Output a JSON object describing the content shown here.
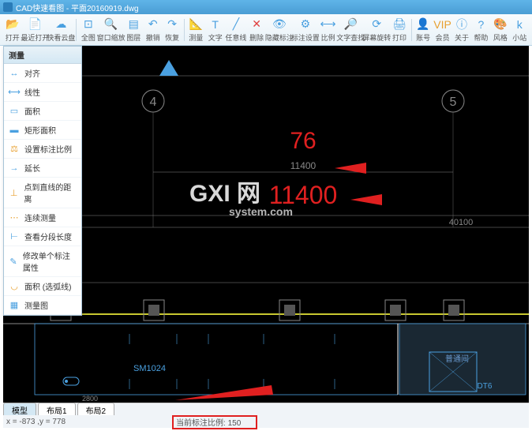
{
  "title": "CAD快速看图 - 平面20160919.dwg",
  "toolbar": [
    {
      "label": "打开",
      "icon": "📂",
      "color": "#e8a030"
    },
    {
      "label": "最近打开",
      "icon": "📄",
      "color": "#e8a030"
    },
    {
      "label": "快看云盘",
      "icon": "☁",
      "color": "#4aa0e0"
    },
    {
      "label": "全图",
      "icon": "⊡",
      "color": "#4aa0e0"
    },
    {
      "label": "窗口缩放",
      "icon": "🔍",
      "color": "#4aa0e0"
    },
    {
      "label": "图层",
      "icon": "▤",
      "color": "#4aa0e0"
    },
    {
      "label": "撤销",
      "icon": "↶",
      "color": "#4aa0e0"
    },
    {
      "label": "恢复",
      "icon": "↷",
      "color": "#4aa0e0"
    },
    {
      "label": "测量",
      "icon": "📐",
      "color": "#e8a030"
    },
    {
      "label": "文字",
      "icon": "T",
      "color": "#4aa0e0"
    },
    {
      "label": "任意线",
      "icon": "╱",
      "color": "#4aa0e0"
    },
    {
      "label": "删除",
      "icon": "✕",
      "color": "#e04040"
    },
    {
      "label": "隐藏标注",
      "icon": "👁",
      "color": "#4aa0e0"
    },
    {
      "label": "标注设置",
      "icon": "⚙",
      "color": "#4aa0e0"
    },
    {
      "label": "比例",
      "icon": "⟷",
      "color": "#4aa0e0"
    },
    {
      "label": "文字查找",
      "icon": "🔎",
      "color": "#4aa0e0"
    },
    {
      "label": "屏幕旋转",
      "icon": "⟳",
      "color": "#4aa0e0"
    },
    {
      "label": "打印",
      "icon": "🖨",
      "color": "#4aa0e0"
    },
    {
      "label": "账号",
      "icon": "👤",
      "color": "#e8a030"
    },
    {
      "label": "会员",
      "icon": "VIP",
      "color": "#e8a030"
    },
    {
      "label": "关于",
      "icon": "ⓘ",
      "color": "#4aa0e0"
    },
    {
      "label": "帮助",
      "icon": "?",
      "color": "#4aa0e0"
    },
    {
      "label": "风格",
      "icon": "🎨",
      "color": "#4aa0e0"
    },
    {
      "label": "小站",
      "icon": "k",
      "color": "#4aa0e0"
    }
  ],
  "dropdown": {
    "header": "测量",
    "items": [
      {
        "label": "对齐",
        "icon": "↔",
        "color": "#4aa0e0"
      },
      {
        "label": "线性",
        "icon": "⟷",
        "color": "#4aa0e0"
      },
      {
        "label": "面积",
        "icon": "▭",
        "color": "#4aa0e0"
      },
      {
        "label": "矩形面积",
        "icon": "▬",
        "color": "#4aa0e0"
      },
      {
        "label": "设置标注比例",
        "icon": "⚖",
        "color": "#e8a030"
      },
      {
        "label": "延长",
        "icon": "→",
        "color": "#4aa0e0"
      },
      {
        "label": "点到直线的距离",
        "icon": "⊥",
        "color": "#e8a030"
      },
      {
        "label": "连续测量",
        "icon": "⋯",
        "color": "#e8a030"
      },
      {
        "label": "查看分段长度",
        "icon": "⊢",
        "color": "#4aa0e0"
      },
      {
        "label": "修改单个标注属性",
        "icon": "✎",
        "color": "#4aa0e0"
      },
      {
        "label": "面积 (选弧线)",
        "icon": "◡",
        "color": "#e8a030"
      },
      {
        "label": "测量图",
        "icon": "▦",
        "color": "#4aa0e0"
      }
    ]
  },
  "drawing": {
    "axis_labels": {
      "left": "4",
      "right": "5"
    },
    "dimensions": {
      "top_value": "76",
      "mid_value": "11400",
      "main_value": "11400",
      "right_value": "40100"
    },
    "room_labels": {
      "sm": "SM1024",
      "dt": "DT6"
    },
    "small_dim": "2800"
  },
  "tabs": [
    {
      "label": "模型",
      "active": true
    },
    {
      "label": "布局1",
      "active": false
    },
    {
      "label": "布局2",
      "active": false
    }
  ],
  "status": {
    "coords": "x = -873 ,y = 778",
    "scale_label": "当前标注比例: 150"
  },
  "watermark": {
    "main": "GXI 网",
    "sub": "system.com"
  }
}
